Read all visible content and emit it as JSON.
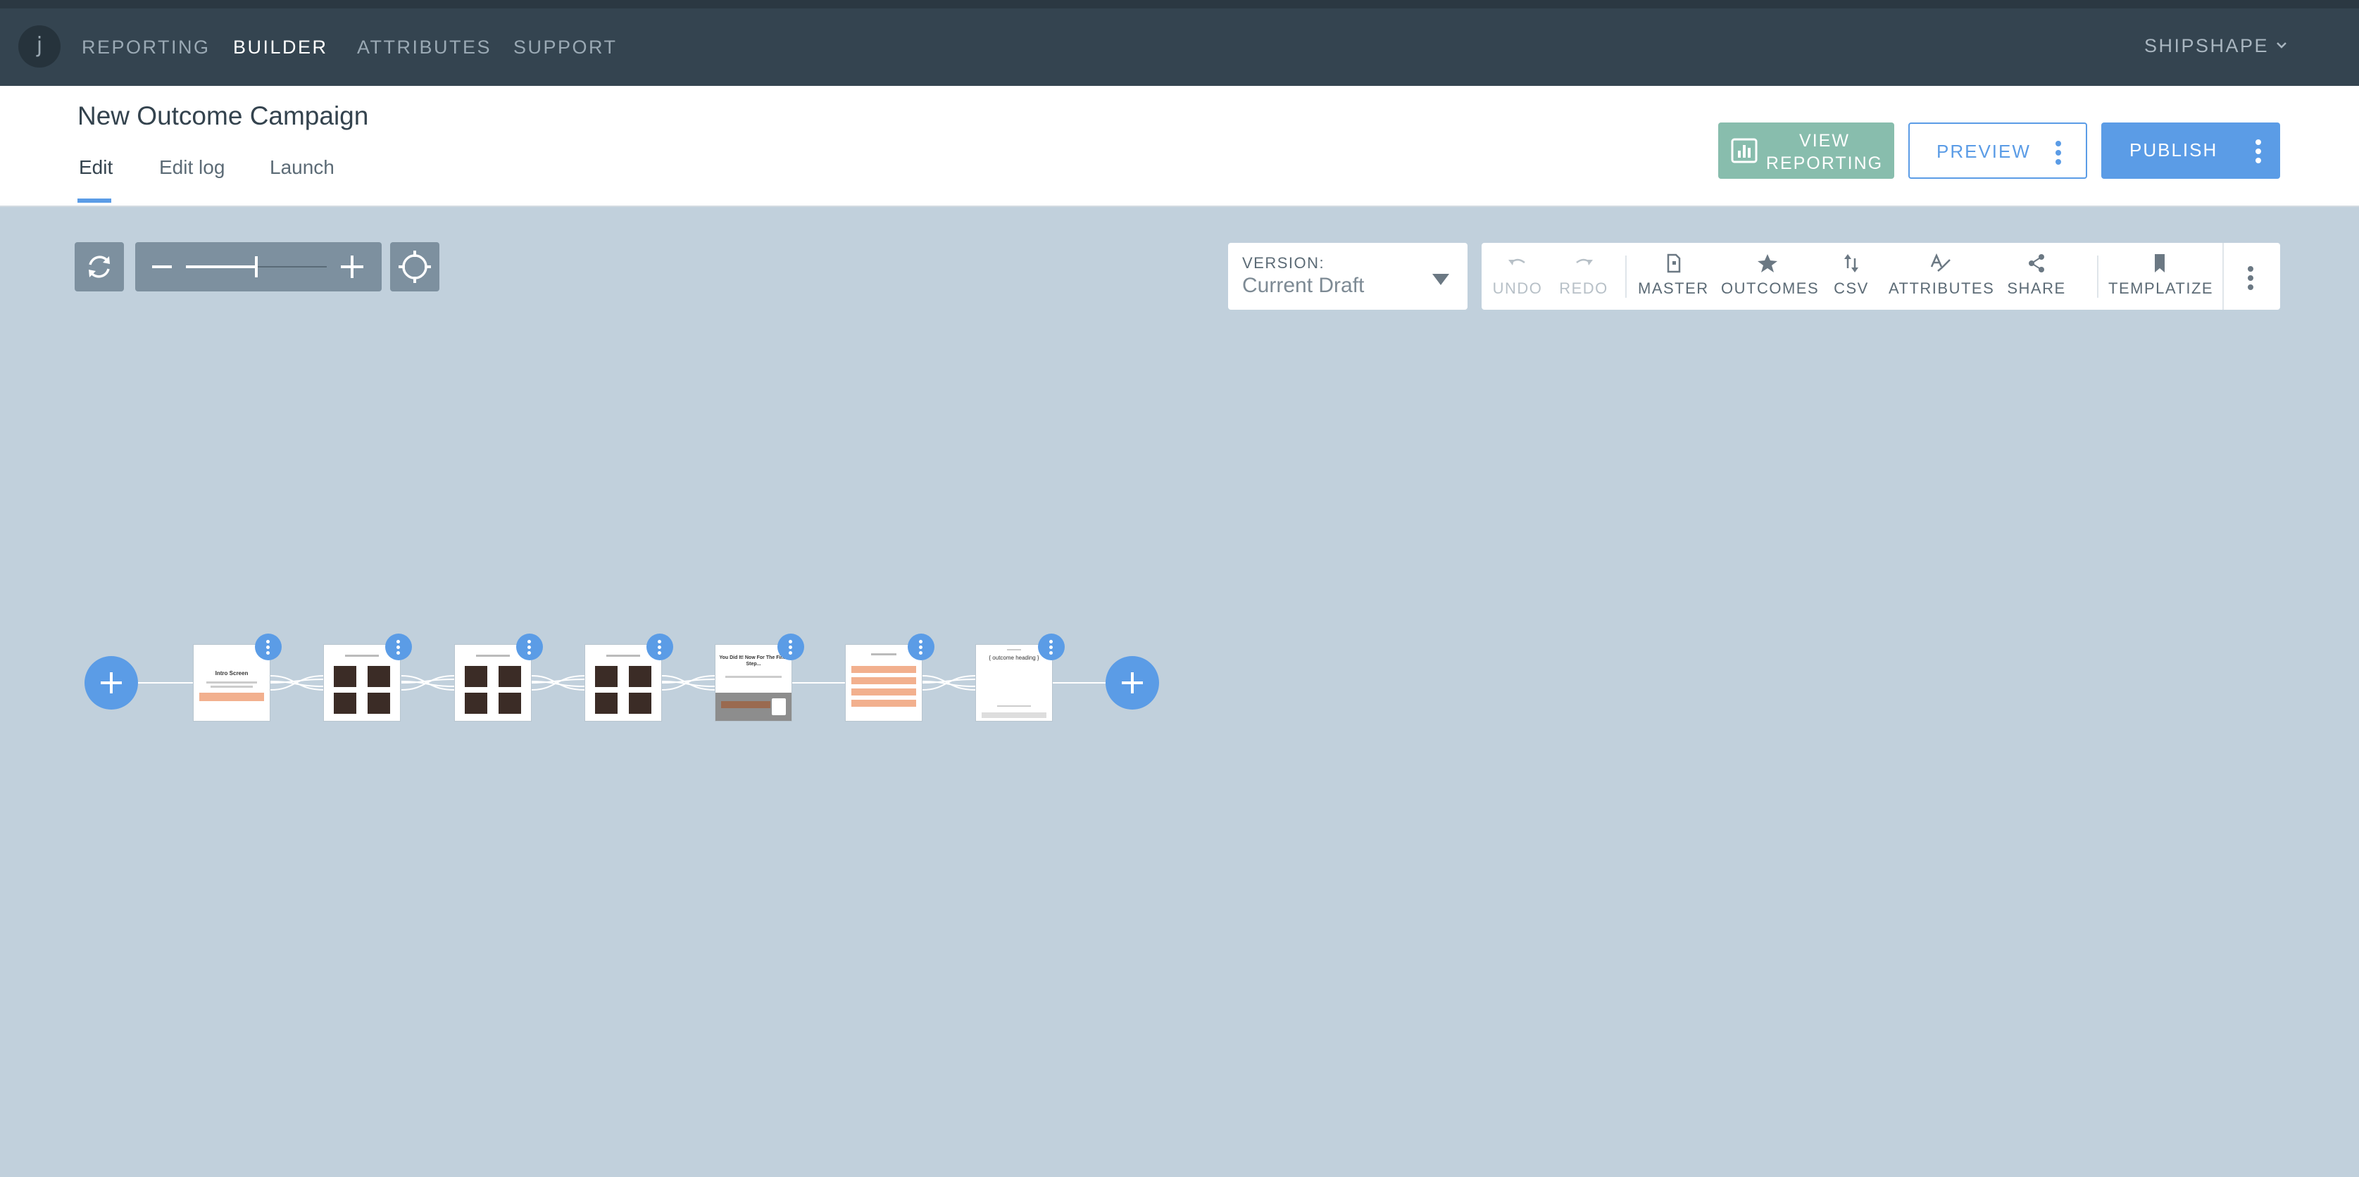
{
  "nav": {
    "logo_letter": "j",
    "items": [
      {
        "label": "REPORTING",
        "active": false
      },
      {
        "label": "BUILDER",
        "active": true
      },
      {
        "label": "ATTRIBUTES",
        "active": false
      },
      {
        "label": "SUPPORT",
        "active": false
      }
    ],
    "account": "SHIPSHAPE"
  },
  "header": {
    "title": "New Outcome Campaign",
    "tabs": [
      {
        "label": "Edit",
        "active": true
      },
      {
        "label": "Edit log",
        "active": false
      },
      {
        "label": "Launch",
        "active": false
      }
    ],
    "view_reporting_line1": "VIEW",
    "view_reporting_line2": "REPORTING",
    "preview_label": "PREVIEW",
    "publish_label": "PUBLISH"
  },
  "canvas": {
    "zoom_level": 0.5,
    "version": {
      "label": "VERSION:",
      "value": "Current Draft"
    },
    "toolbar": [
      {
        "label": "UNDO",
        "icon": "undo-icon",
        "enabled": false
      },
      {
        "label": "REDO",
        "icon": "redo-icon",
        "enabled": false
      },
      {
        "label": "MASTER",
        "icon": "master-page-icon",
        "enabled": true
      },
      {
        "label": "OUTCOMES",
        "icon": "star-icon",
        "enabled": true
      },
      {
        "label": "CSV",
        "icon": "swap-arrows-icon",
        "enabled": true
      },
      {
        "label": "ATTRIBUTES",
        "icon": "attributes-icon",
        "enabled": true
      },
      {
        "label": "SHARE",
        "icon": "share-icon",
        "enabled": true
      },
      {
        "label": "TEMPLATIZE",
        "icon": "bookmark-icon",
        "enabled": true
      }
    ]
  },
  "flow": {
    "screens": [
      {
        "name": "intro-screen",
        "heading": "Intro Screen"
      },
      {
        "name": "question-screen-1",
        "heading": ""
      },
      {
        "name": "question-screen-2",
        "heading": ""
      },
      {
        "name": "question-screen-3",
        "heading": ""
      },
      {
        "name": "lead-capture-screen",
        "heading": "You Did It! Now For The Final Step..."
      },
      {
        "name": "answers-screen",
        "heading": ""
      },
      {
        "name": "outcome-screen",
        "heading": "{ outcome heading }"
      }
    ]
  },
  "colors": {
    "nav_bg": "#344450",
    "canvas_bg": "#c1d0dc",
    "accent": "#5b9ce6",
    "reporting_btn": "#88bdad",
    "control_bg": "#7d909f"
  }
}
